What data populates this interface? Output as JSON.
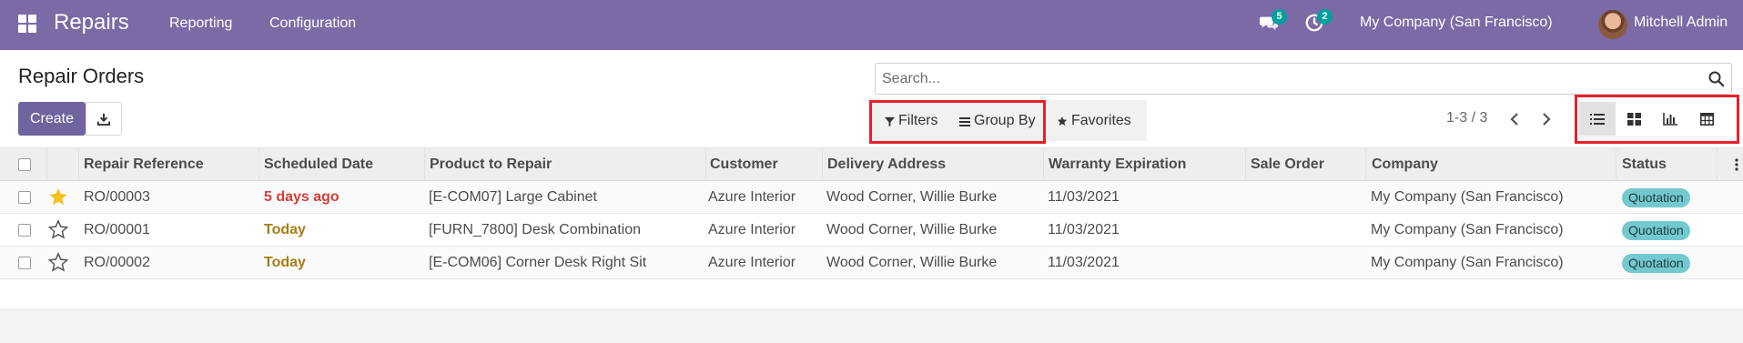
{
  "navbar": {
    "app_name": "Repairs",
    "menu": [
      "Reporting",
      "Configuration"
    ],
    "messages_count": "5",
    "activities_count": "2",
    "company": "My Company (San Francisco)",
    "user": "Mitchell Admin"
  },
  "control_panel": {
    "title": "Repair Orders",
    "create_label": "Create",
    "search_placeholder": "Search...",
    "filters_label": "Filters",
    "group_by_label": "Group By",
    "favorites_label": "Favorites",
    "pager": "1-3 / 3",
    "views": [
      "list-view",
      "kanban-view",
      "graph-view",
      "pivot-view"
    ],
    "active_view": "list-view"
  },
  "table": {
    "columns": [
      "Repair Reference",
      "Scheduled Date",
      "Product to Repair",
      "Customer",
      "Delivery Address",
      "Warranty Expiration",
      "Sale Order",
      "Company",
      "Status"
    ],
    "rows": [
      {
        "starred": true,
        "reference": "RO/00003",
        "scheduled": "5 days ago",
        "scheduled_state": "overdue",
        "product": "[E-COM07] Large Cabinet",
        "customer": "Azure Interior",
        "address": "Wood Corner, Willie Burke",
        "warranty": "11/03/2021",
        "sale_order": "",
        "company": "My Company (San Francisco)",
        "status": "Quotation"
      },
      {
        "starred": false,
        "reference": "RO/00001",
        "scheduled": "Today",
        "scheduled_state": "today",
        "product": "[FURN_7800] Desk Combination",
        "customer": "Azure Interior",
        "address": "Wood Corner, Willie Burke",
        "warranty": "11/03/2021",
        "sale_order": "",
        "company": "My Company (San Francisco)",
        "status": "Quotation"
      },
      {
        "starred": false,
        "reference": "RO/00002",
        "scheduled": "Today",
        "scheduled_state": "today",
        "product": "[E-COM06] Corner Desk Right Sit",
        "customer": "Azure Interior",
        "address": "Wood Corner, Willie Burke",
        "warranty": "11/03/2021",
        "sale_order": "",
        "company": "My Company (San Francisco)",
        "status": "Quotation"
      }
    ]
  },
  "colors": {
    "navbar": "#7c6aa6",
    "primary_button": "#71639e",
    "highlight_box": "#e8202a",
    "status_badge": "#74c9cf",
    "overdue_date": "#d23f3a",
    "today_date": "#a87d14",
    "star_filled": "#f3c01c",
    "notification_badge": "#00a09d"
  }
}
